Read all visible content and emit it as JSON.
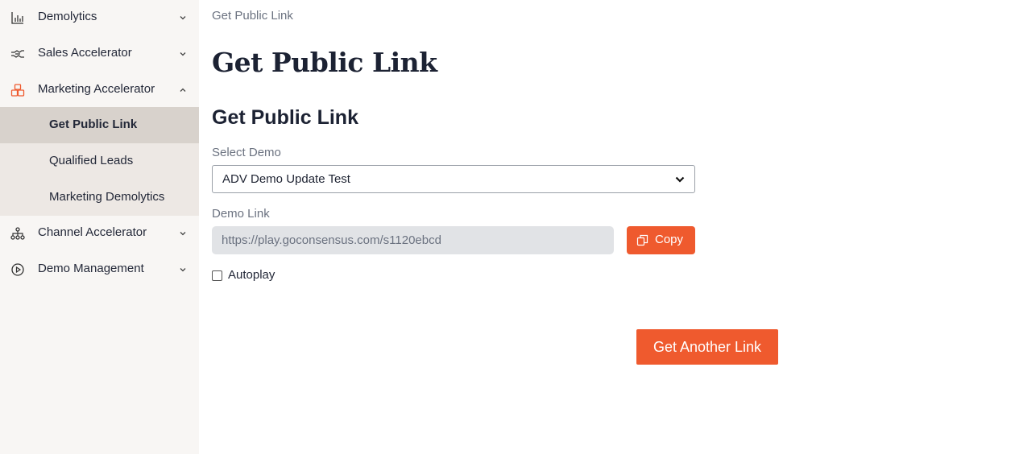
{
  "sidebar": {
    "items": [
      {
        "label": "Demolytics",
        "icon": "bar-chart-icon",
        "chevron": "down"
      },
      {
        "label": "Sales Accelerator",
        "icon": "handshake-icon",
        "chevron": "down"
      },
      {
        "label": "Marketing Accelerator",
        "icon": "boxes-icon",
        "chevron": "up",
        "expanded": true
      },
      {
        "label": "Channel Accelerator",
        "icon": "network-icon",
        "chevron": "down"
      },
      {
        "label": "Demo Management",
        "icon": "play-circle-icon",
        "chevron": "down"
      }
    ],
    "subitems": [
      {
        "label": "Get Public Link",
        "active": true
      },
      {
        "label": "Qualified Leads"
      },
      {
        "label": "Marketing Demolytics"
      }
    ],
    "accent_color": "#ef5a2e"
  },
  "main": {
    "breadcrumb": "Get Public Link",
    "page_title": "Get Public Link",
    "section_title": "Get Public Link",
    "select_label": "Select Demo",
    "select_value": "ADV Demo Update Test",
    "link_label": "Demo Link",
    "link_value": "https://play.goconsensus.com/s1120ebcd",
    "copy_label": "Copy",
    "autoplay_label": "Autoplay",
    "autoplay_checked": false,
    "another_link_label": "Get Another Link",
    "button_color": "#ef5a2e"
  }
}
